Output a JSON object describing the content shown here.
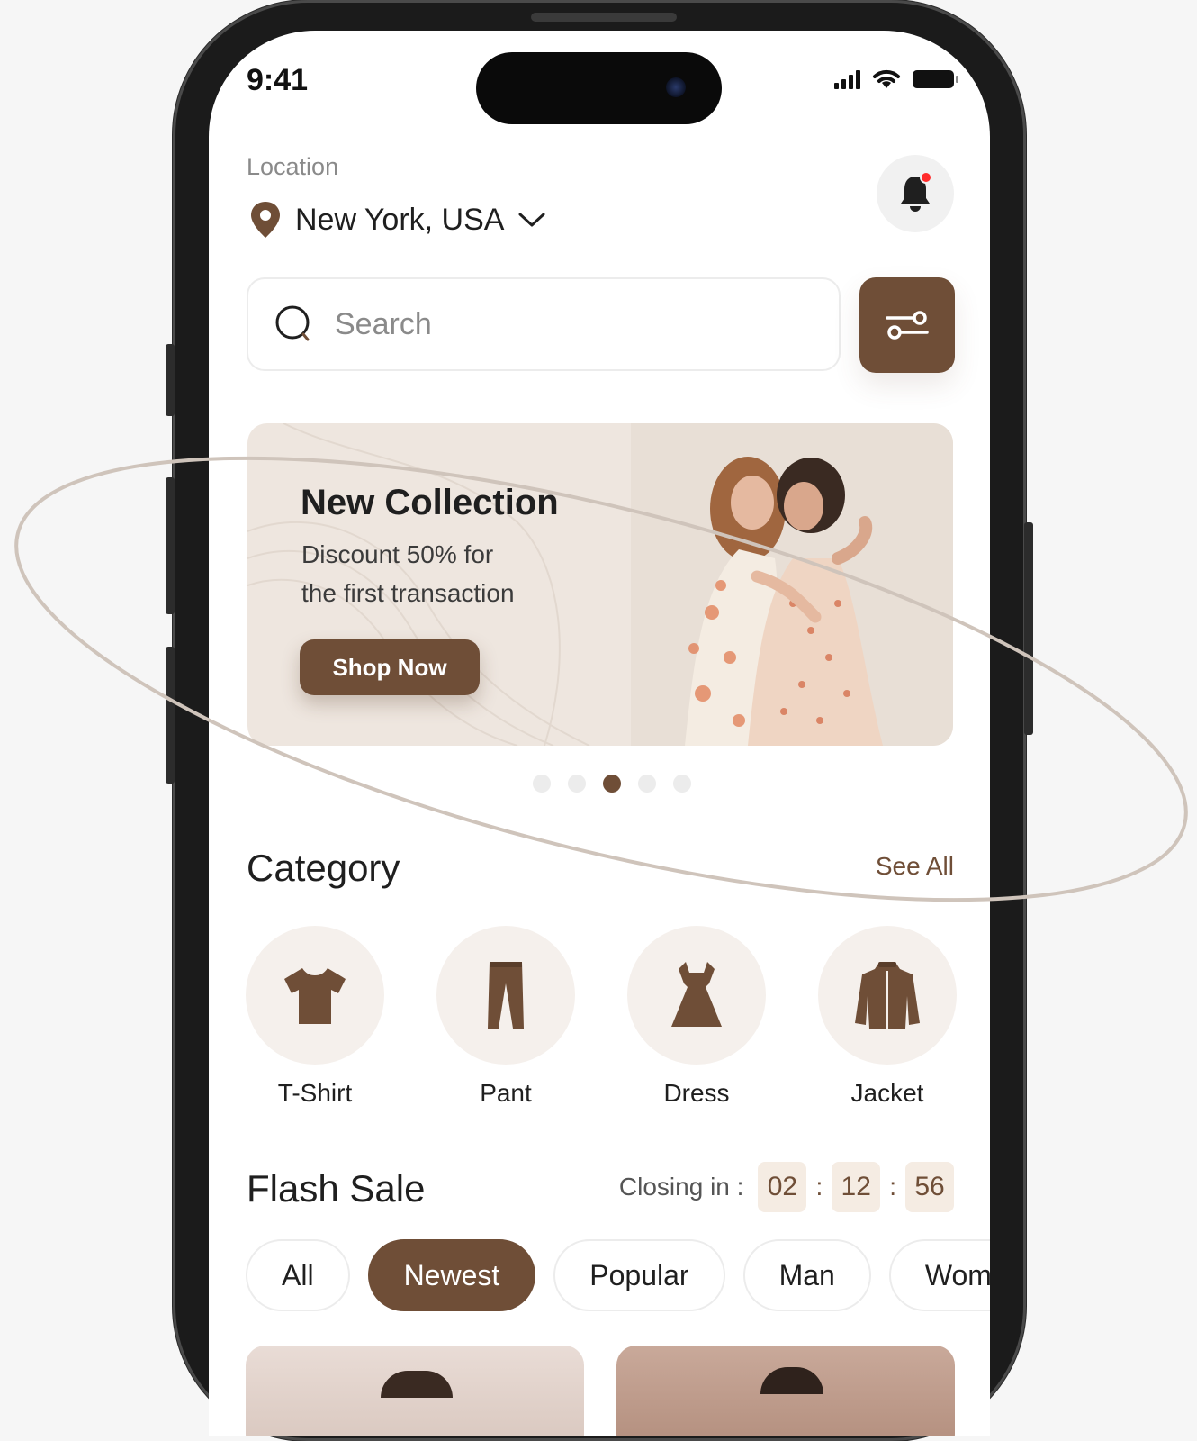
{
  "status": {
    "time": "9:41"
  },
  "location": {
    "label": "Location",
    "value": "New York, USA"
  },
  "search": {
    "placeholder": "Search"
  },
  "banner": {
    "title": "New Collection",
    "subtitle_line1": "Discount 50% for",
    "subtitle_line2": "the first transaction",
    "cta": "Shop Now"
  },
  "carousel": {
    "active_index": 2,
    "count": 5
  },
  "category": {
    "title": "Category",
    "see_all": "See All",
    "items": [
      {
        "label": "T-Shirt",
        "icon": "tshirt-icon"
      },
      {
        "label": "Pant",
        "icon": "pant-icon"
      },
      {
        "label": "Dress",
        "icon": "dress-icon"
      },
      {
        "label": "Jacket",
        "icon": "jacket-icon"
      }
    ]
  },
  "flash_sale": {
    "title": "Flash Sale",
    "closing_label": "Closing in :",
    "hours": "02",
    "minutes": "12",
    "seconds": "56",
    "filters": [
      "All",
      "Newest",
      "Popular",
      "Man",
      "Woman"
    ],
    "active_filter": "Newest"
  },
  "colors": {
    "accent": "#6f4e37",
    "banner_bg": "#eee6df",
    "category_bg": "#f5f0ec",
    "notification_dot": "#ff2b2b"
  }
}
